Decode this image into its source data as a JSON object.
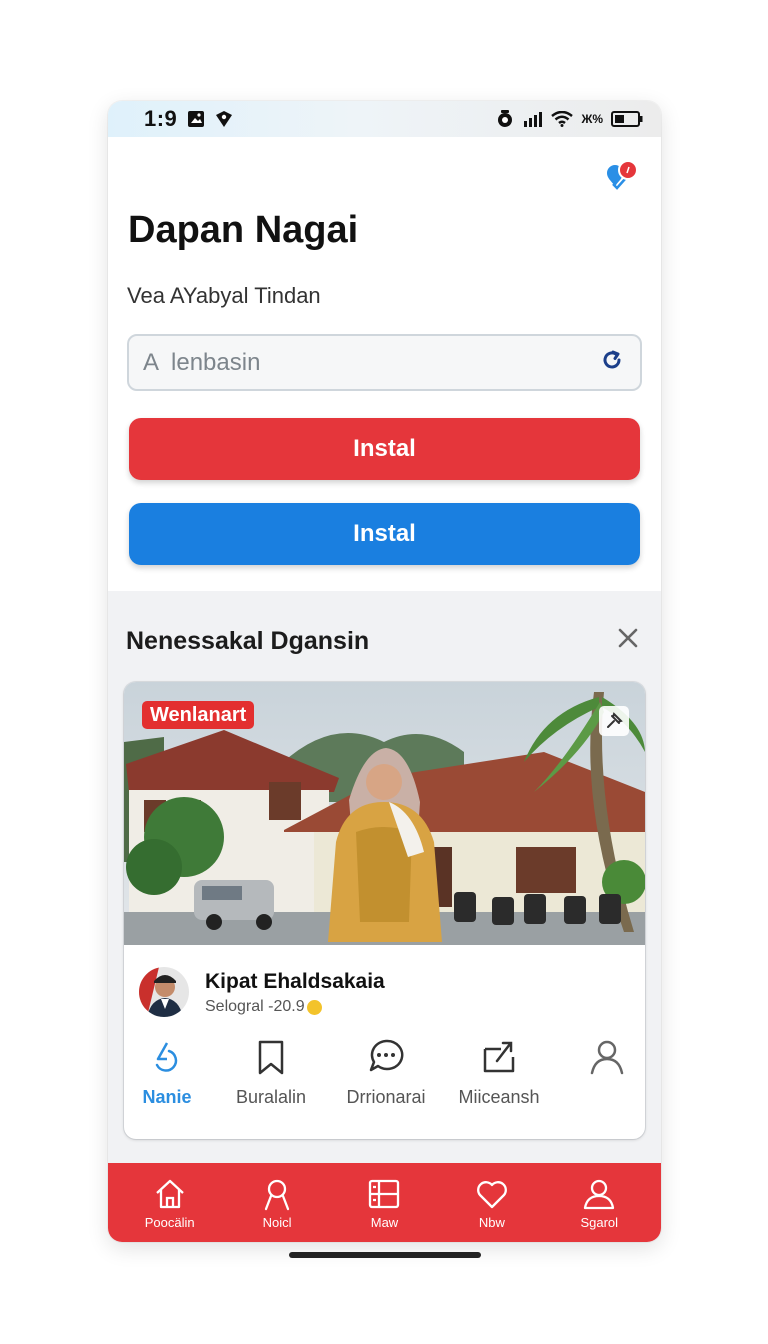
{
  "status": {
    "time": "1:9",
    "carrier_text": "Ж%"
  },
  "header": {
    "title": "Dapan Nagai",
    "subtitle": "Vea AYabyal Tindan"
  },
  "search": {
    "placeholder": "A  lenbasin"
  },
  "buttons": {
    "primary_label": "Instal",
    "secondary_label": "Instal"
  },
  "colors": {
    "red": "#e5363b",
    "blue": "#1a7fe0",
    "active": "#2b8ee0"
  },
  "feed": {
    "section_title": "Nenessakal Dgansin",
    "card": {
      "badge": "Wenlanart",
      "author_name": "Kipat Ehaldsakaia",
      "author_meta": "Selogral -20.9",
      "actions": [
        {
          "label": "Nanie",
          "icon": "refresh-icon",
          "active": true
        },
        {
          "label": "Buralalin",
          "icon": "bookmark-icon",
          "active": false
        },
        {
          "label": "Drrionarai",
          "icon": "comment-icon",
          "active": false
        },
        {
          "label": "Miiceansh",
          "icon": "share-icon",
          "active": false
        },
        {
          "label": "",
          "icon": "user-icon",
          "active": false
        }
      ]
    }
  },
  "bottom_nav": [
    {
      "label": "Poocälin",
      "icon": "home-icon"
    },
    {
      "label": "Noicl",
      "icon": "person-icon"
    },
    {
      "label": "Maw",
      "icon": "list-icon"
    },
    {
      "label": "Nbw",
      "icon": "heart-icon"
    },
    {
      "label": "Sgarol",
      "icon": "profile-icon"
    }
  ]
}
